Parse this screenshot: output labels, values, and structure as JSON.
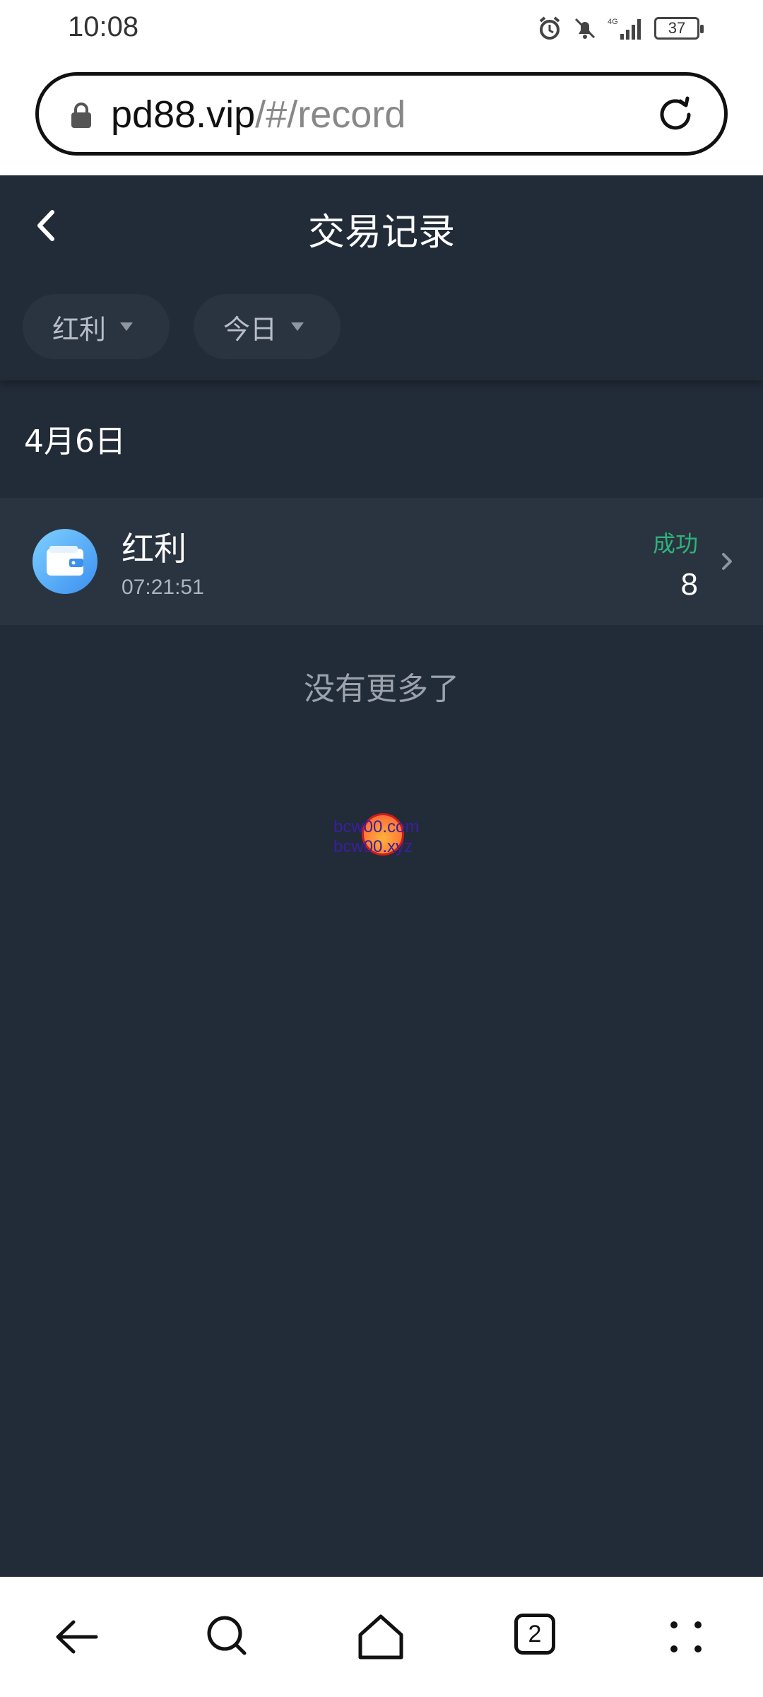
{
  "status_bar": {
    "time": "10:08",
    "battery": "37",
    "network": "4G"
  },
  "browser": {
    "url_host": "pd88.vip",
    "url_path": "/#/record",
    "tab_count": "2"
  },
  "page": {
    "title": "交易记录",
    "filters": {
      "type_label": "红利",
      "date_label": "今日"
    },
    "date_group": "4月6日",
    "records": [
      {
        "name": "红利",
        "time": "07:21:51",
        "status": "成功",
        "amount": "8",
        "icon": "wallet-icon"
      }
    ],
    "no_more_text": "没有更多了"
  },
  "watermark": {
    "line1": "bcw00.com",
    "line2": "bcw00.xyz"
  },
  "colors": {
    "background": "#222b38",
    "row_background": "#2a3440",
    "success": "#2fb27a",
    "accent_icon": "#3b8ff0"
  }
}
